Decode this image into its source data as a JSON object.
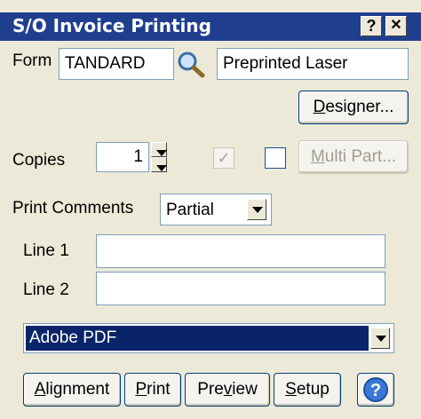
{
  "window": {
    "title": "S/O Invoice Printing"
  },
  "titlebar": {
    "help": "?",
    "close": "✕"
  },
  "form": {
    "label": "Form",
    "code_value": "TANDARD",
    "description_value": "Preprinted Laser"
  },
  "designer_button": {
    "label_pre": "",
    "label_hot": "D",
    "label_post": "esigner..."
  },
  "copies": {
    "label": "Copies",
    "value": "1"
  },
  "checks": {
    "collated_checked": "✓"
  },
  "multipart_button": {
    "label_pre": "",
    "label_hot": "M",
    "label_post": "ulti Part..."
  },
  "print_comments": {
    "label": "Print Comments",
    "selected": "Partial"
  },
  "line1": {
    "label": "Line 1",
    "value": ""
  },
  "line2": {
    "label": "Line 2",
    "value": ""
  },
  "printer": {
    "selected": "Adobe PDF"
  },
  "bottom_buttons": {
    "alignment": {
      "pre": "",
      "hot": "A",
      "post": "lignment"
    },
    "print": {
      "pre": "",
      "hot": "P",
      "post": "rint"
    },
    "preview": {
      "pre": "Pre",
      "hot": "v",
      "post": "iew"
    },
    "setup": {
      "pre": "",
      "hot": "S",
      "post": "etup"
    }
  },
  "colors": {
    "title_bar": "#1f3f8e",
    "selection": "#0a246a",
    "window_bg": "#ece9d8"
  }
}
